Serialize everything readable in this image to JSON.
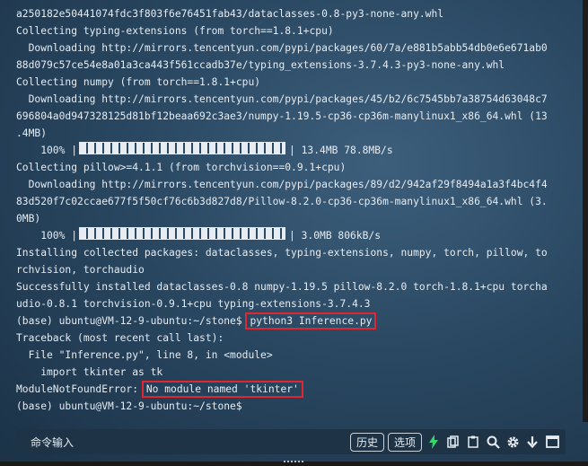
{
  "terminal": {
    "lines": [
      "a250182e50441074fdc3f803f6e76451fab43/dataclasses-0.8-py3-none-any.whl",
      "Collecting typing-extensions (from torch==1.8.1+cpu)",
      "  Downloading http://mirrors.tencentyun.com/pypi/packages/60/7a/e881b5abb54db0e6e671ab0",
      "88d079c57ce54e8a01a3ca443f561ccadb37e/typing_extensions-3.7.4.3-py3-none-any.whl",
      "Collecting numpy (from torch==1.8.1+cpu)",
      "  Downloading http://mirrors.tencentyun.com/pypi/packages/45/b2/6c7545bb7a38754d63048c7",
      "696804a0d947328125d81bf12beaa692c3ae3/numpy-1.19.5-cp36-cp36m-manylinux1_x86_64.whl (13",
      ".4MB)"
    ],
    "progress1": {
      "percent": "    100% |",
      "suffix": "| 13.4MB 78.8MB/s"
    },
    "lines2": [
      "Collecting pillow>=4.1.1 (from torchvision==0.9.1+cpu)",
      "  Downloading http://mirrors.tencentyun.com/pypi/packages/89/d2/942af29f8494a1a3f4bc4f4",
      "83d520f7c02ccae677f5f50cf76c6b3d827d8/Pillow-8.2.0-cp36-cp36m-manylinux1_x86_64.whl (3.",
      "0MB)"
    ],
    "progress2": {
      "percent": "    100% |",
      "suffix": "| 3.0MB 806kB/s"
    },
    "lines3": [
      "Installing collected packages: dataclasses, typing-extensions, numpy, torch, pillow, to",
      "rchvision, torchaudio",
      "Successfully installed dataclasses-0.8 numpy-1.19.5 pillow-8.2.0 torch-1.8.1+cpu torcha",
      "udio-0.8.1 torchvision-0.9.1+cpu typing-extensions-3.7.4.3"
    ],
    "prompt1": "(base) ubuntu@VM-12-9-ubuntu:~/stone$ ",
    "command1": "python3 Inference.py",
    "lines4": [
      "Traceback (most recent call last):",
      "  File \"Inference.py\", line 8, in <module>",
      "    import tkinter as tk"
    ],
    "error_prefix": "ModuleNotFoundError: ",
    "error_msg": "No module named 'tkinter'",
    "prompt2": "(base) ubuntu@VM-12-9-ubuntu:~/stone$"
  },
  "toolbar": {
    "command_input_label": "命令输入",
    "history_button": "历史",
    "options_button": "选项"
  },
  "icons": [
    "bolt-icon",
    "copy-icon",
    "paste-icon",
    "search-icon",
    "gear-icon",
    "download-icon",
    "fullscreen-icon"
  ],
  "colors": {
    "highlight": "#e0262e",
    "bolt": "#36d66b"
  }
}
